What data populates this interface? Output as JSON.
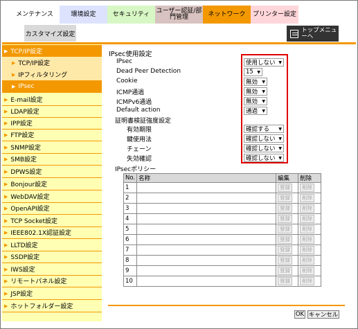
{
  "tabs": [
    {
      "label": "メンテナンス",
      "bg": "#ffffff"
    },
    {
      "label": "環境設定",
      "bg": "#dde3ff"
    },
    {
      "label": "セキュリティ",
      "bg": "#d7f7c4"
    },
    {
      "label": "ユーザー認証/部門管理",
      "bg": "#d8c3c0"
    },
    {
      "label": "ネットワーク",
      "bg": "#f39800"
    },
    {
      "label": "プリンター設定",
      "bg": "#ffd6da"
    }
  ],
  "subtab": {
    "label": "カスタマイズ設定"
  },
  "topmenu": {
    "label": "トップメニューへ"
  },
  "sidebar": {
    "items": [
      {
        "label": "TCP/IP設定",
        "type": "active"
      },
      {
        "label": "TCP/IP設定",
        "type": "sub"
      },
      {
        "label": "IPフィルタリング",
        "type": "sub"
      },
      {
        "label": "IPsec",
        "type": "sub-sel"
      },
      {
        "label": "E-mail設定",
        "type": "item"
      },
      {
        "label": "LDAP設定",
        "type": "item"
      },
      {
        "label": "IPP設定",
        "type": "item"
      },
      {
        "label": "FTP設定",
        "type": "item"
      },
      {
        "label": "SNMP設定",
        "type": "item"
      },
      {
        "label": "SMB設定",
        "type": "item"
      },
      {
        "label": "DPWS設定",
        "type": "item"
      },
      {
        "label": "Bonjour設定",
        "type": "item"
      },
      {
        "label": "WebDAV設定",
        "type": "item"
      },
      {
        "label": "OpenAPI設定",
        "type": "item"
      },
      {
        "label": "TCP Socket設定",
        "type": "item"
      },
      {
        "label": "IEEE802.1X認証設定",
        "type": "item"
      },
      {
        "label": "LLTD設定",
        "type": "item"
      },
      {
        "label": "SSDP設定",
        "type": "item"
      },
      {
        "label": "IWS設定",
        "type": "item"
      },
      {
        "label": "リモートパネル設定",
        "type": "item"
      },
      {
        "label": "JSP設定",
        "type": "item"
      },
      {
        "label": "ホットフォルダー設定",
        "type": "item"
      }
    ]
  },
  "main": {
    "title": "IPsec使用設定",
    "fields": [
      {
        "label": "IPsec",
        "value": "使用しない"
      },
      {
        "label": "Dead Peer Detection",
        "value": "15"
      },
      {
        "label": "Cookie",
        "value": "無効"
      },
      {
        "label": "ICMP通過",
        "value": "無効"
      },
      {
        "label": "ICMPv6通過",
        "value": "無効"
      },
      {
        "label": "Default action",
        "value": "通過"
      }
    ],
    "cert_title": "証明書検証強度設定",
    "cert_fields": [
      {
        "label": "有効期限",
        "value": "確認する"
      },
      {
        "label": "鍵使用法",
        "value": "確認しない"
      },
      {
        "label": "チェーン",
        "value": "確認しない"
      },
      {
        "label": "失効確認",
        "value": "確認しない"
      }
    ],
    "policy_title": "IPsecポリシー",
    "policy_headers": {
      "no": "No.",
      "name": "名称",
      "edit": "編集",
      "del": "削除"
    },
    "policy_rows": [
      "1",
      "2",
      "3",
      "4",
      "5",
      "6",
      "7",
      "8",
      "9",
      "10"
    ],
    "register_label": "登録",
    "delete_label": "削除"
  },
  "buttons": {
    "ok": "OK",
    "cancel": "キャンセル"
  }
}
